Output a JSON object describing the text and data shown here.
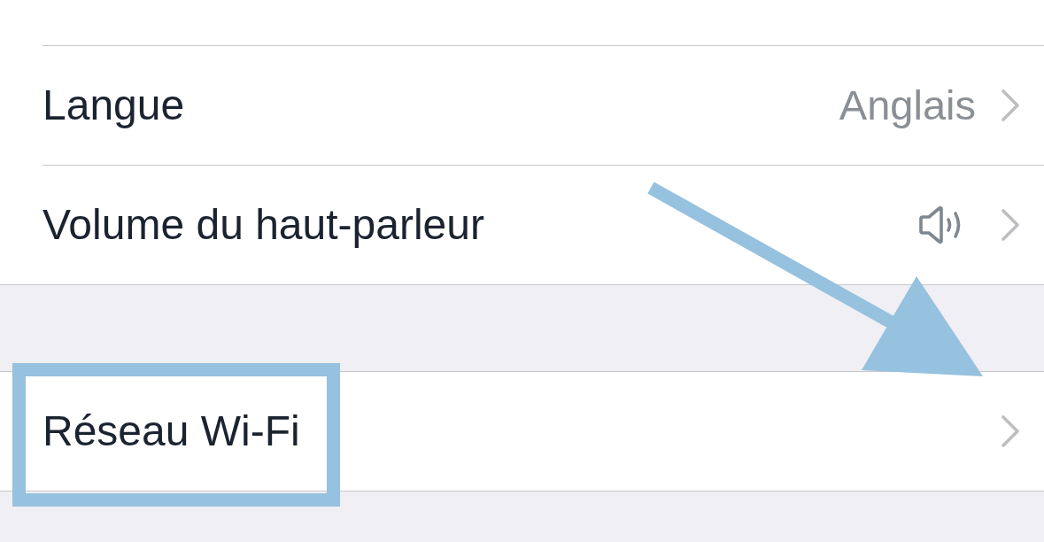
{
  "settings_list": {
    "groups": [
      {
        "rows": [
          {
            "kind": "partial",
            "highlighted": false
          },
          {
            "kind": "value",
            "label": "Langue",
            "value": "Anglais",
            "highlighted": false
          },
          {
            "kind": "volume",
            "label": "Volume du haut-parleur",
            "highlighted": false
          }
        ]
      },
      {
        "rows": [
          {
            "kind": "link",
            "label": "Réseau Wi-Fi",
            "highlighted": true
          }
        ]
      }
    ]
  }
}
